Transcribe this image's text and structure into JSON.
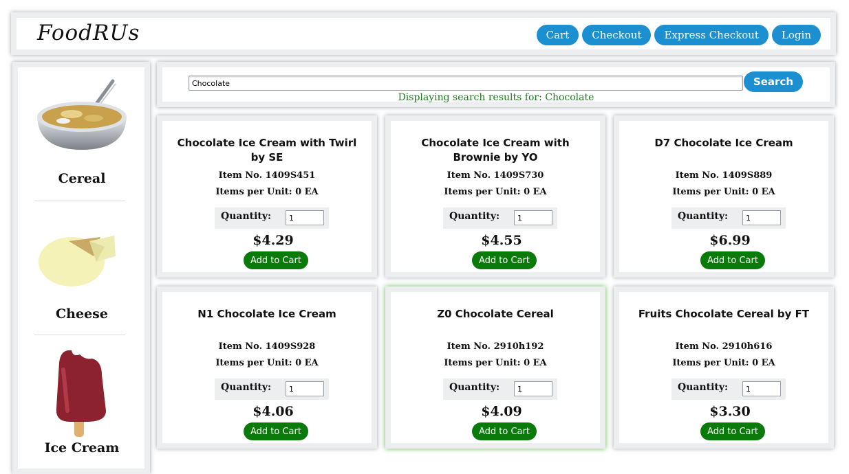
{
  "header": {
    "logo": "FoodRUs",
    "nav": {
      "cart": "Cart",
      "checkout": "Checkout",
      "express_checkout": "Express Checkout",
      "login": "Login"
    }
  },
  "sidebar": {
    "categories": [
      {
        "label": "Cereal",
        "icon": "cereal-bowl-icon"
      },
      {
        "label": "Cheese",
        "icon": "cheese-icon"
      },
      {
        "label": "Ice Cream",
        "icon": "ice-cream-bar-icon"
      }
    ]
  },
  "search": {
    "value": "Chocolate",
    "button_label": "Search",
    "status": "Displaying search results for: Chocolate"
  },
  "colors": {
    "nav_button": "#1b8fd0",
    "add_button": "#0a7a0a",
    "status_text": "#1b7a1b",
    "panel_border": "#eceeef"
  },
  "products": [
    {
      "name": "Chocolate Ice Cream with Twirl by SE",
      "item_no": "Item No. 1409S451",
      "units": "Items per Unit: 0 EA",
      "qty_label": "Quantity:",
      "qty": "1",
      "price": "$4.29",
      "add_label": "Add to Cart"
    },
    {
      "name": "Chocolate Ice Cream with Brownie by YO",
      "item_no": "Item No. 1409S730",
      "units": "Items per Unit: 0 EA",
      "qty_label": "Quantity:",
      "qty": "1",
      "price": "$4.55",
      "add_label": "Add to Cart"
    },
    {
      "name": "D7 Chocolate Ice Cream",
      "item_no": "Item No. 1409S889",
      "units": "Items per Unit: 0 EA",
      "qty_label": "Quantity:",
      "qty": "1",
      "price": "$6.99",
      "add_label": "Add to Cart"
    },
    {
      "name": "N1 Chocolate Ice Cream",
      "item_no": "Item No. 1409S928",
      "units": "Items per Unit: 0 EA",
      "qty_label": "Quantity:",
      "qty": "1",
      "price": "$4.06",
      "add_label": "Add to Cart"
    },
    {
      "name": "Z0 Chocolate Cereal",
      "item_no": "Item No. 2910h192",
      "units": "Items per Unit: 0 EA",
      "qty_label": "Quantity:",
      "qty": "1",
      "price": "$4.09",
      "add_label": "Add to Cart"
    },
    {
      "name": "Fruits Chocolate Cereal by FT",
      "item_no": "Item No. 2910h616",
      "units": "Items per Unit: 0 EA",
      "qty_label": "Quantity:",
      "qty": "1",
      "price": "$3.30",
      "add_label": "Add to Cart"
    }
  ]
}
